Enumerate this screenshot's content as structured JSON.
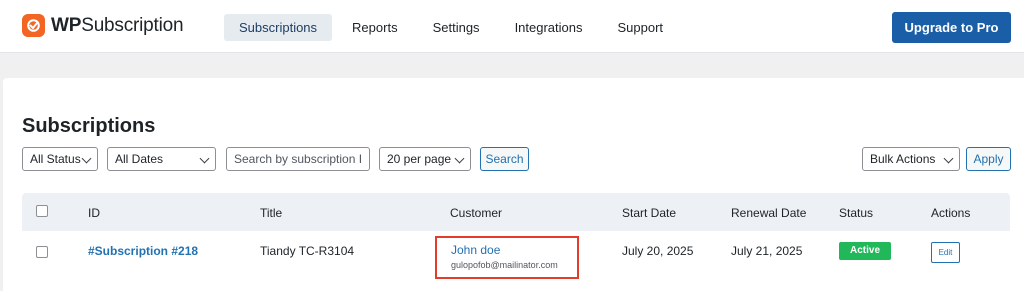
{
  "brand": {
    "prefix": "WP",
    "suffix": "Subscription",
    "accent_color": "#f26522"
  },
  "nav": {
    "items": [
      {
        "label": "Subscriptions",
        "active": true
      },
      {
        "label": "Reports",
        "active": false
      },
      {
        "label": "Settings",
        "active": false
      },
      {
        "label": "Integrations",
        "active": false
      },
      {
        "label": "Support",
        "active": false
      }
    ],
    "upgrade_label": "Upgrade to Pro",
    "upgrade_color": "#1a5ea8"
  },
  "page": {
    "title": "Subscriptions"
  },
  "filters": {
    "status": "All Status",
    "dates": "All Dates",
    "search_placeholder": "Search by subscription I",
    "per_page": "20 per page",
    "search_button": "Search",
    "bulk_actions": "Bulk Actions",
    "apply_button": "Apply"
  },
  "table": {
    "headers": [
      "ID",
      "Title",
      "Customer",
      "Start Date",
      "Renewal Date",
      "Status",
      "Actions"
    ],
    "rows": [
      {
        "id": "#Subscription #218",
        "title": "Tiandy TC-R3104",
        "customer_name": "John doe",
        "customer_email": "gulopofob@mailinator.com",
        "start_date": "July 20, 2025",
        "renewal_date": "July 21, 2025",
        "status": "Active",
        "status_color": "#21b85a",
        "action": "Edit"
      }
    ]
  },
  "highlight_color": "#e23c2b"
}
